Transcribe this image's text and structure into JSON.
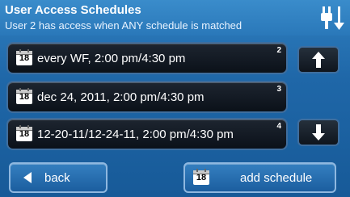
{
  "header": {
    "title": "User Access Schedules",
    "subtitle": "User 2 has access when ANY schedule is matched"
  },
  "icons": {
    "status": "plug-down-icon",
    "calendar": "calendar-icon",
    "calendar_day": "18"
  },
  "schedules": [
    {
      "label": "every WF, 2:00 pm/4:30 pm",
      "number": "2"
    },
    {
      "label": "dec 24, 2011, 2:00 pm/4:30 pm",
      "number": "3"
    },
    {
      "label": "12-20-11/12-24-11, 2:00 pm/4:30 pm",
      "number": "4"
    }
  ],
  "footer": {
    "back_label": "back",
    "add_label": "add schedule"
  }
}
